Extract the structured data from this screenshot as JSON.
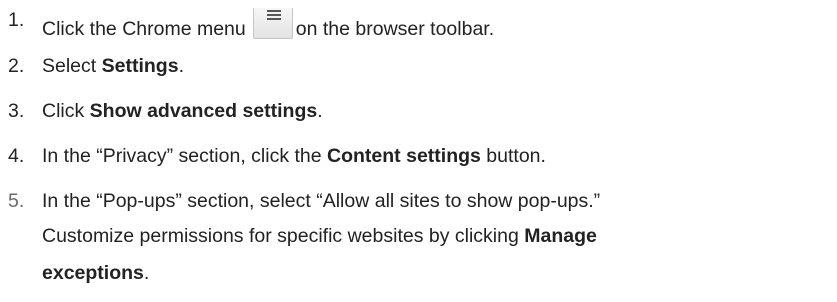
{
  "steps": [
    {
      "num": "1.",
      "before": "Click the Chrome menu",
      "after": "on the browser toolbar.",
      "icon": "chrome-menu-icon"
    },
    {
      "num": "2.",
      "before": "Select ",
      "bold": "Settings",
      "after": "."
    },
    {
      "num": "3.",
      "before": "Click ",
      "bold": "Show advanced settings",
      "after": "."
    },
    {
      "num": "4.",
      "before": "In the “Privacy” section, click the ",
      "bold": "Content settings",
      "after": " button."
    },
    {
      "num": "5.",
      "before": "In the “Pop-ups” section, select “Allow all sites to show pop-ups.”",
      "line2": "Customize permissions for specific websites by clicking ",
      "bold": "Manage",
      "bold2": "exceptions",
      "after": "."
    }
  ],
  "colors": {
    "text": "#222222",
    "faded_number": "#6a6a6a"
  }
}
